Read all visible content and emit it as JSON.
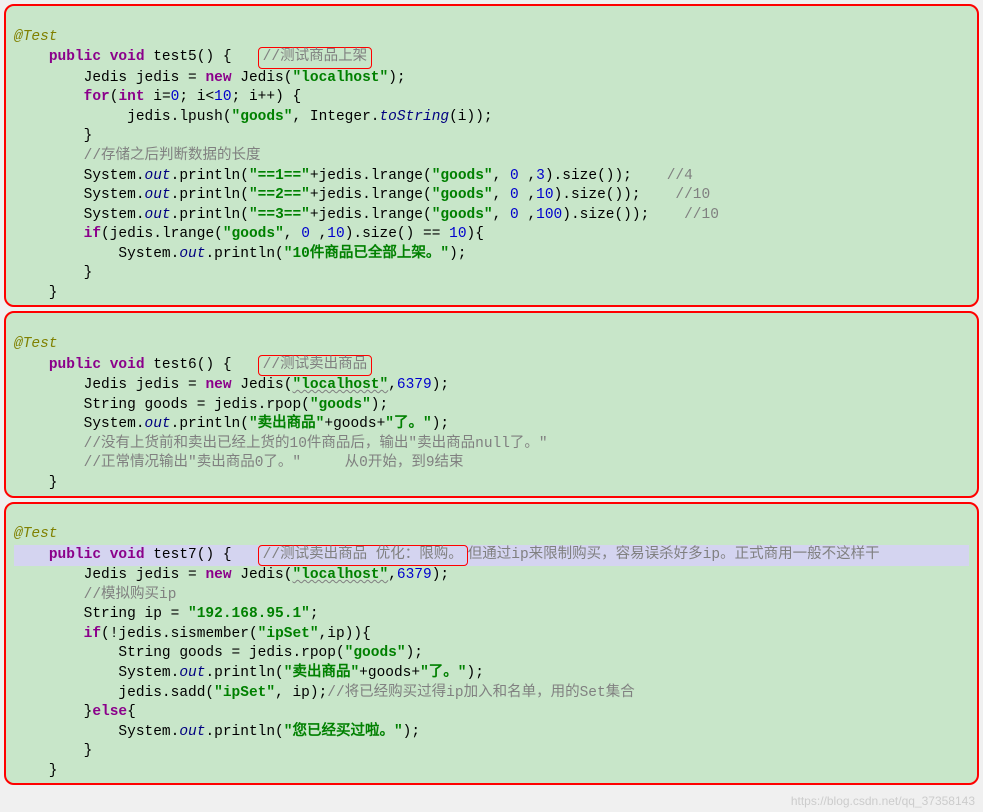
{
  "blocks": {
    "b1": {
      "anno": "@Test",
      "sig_pre": "public void",
      "sig_name": " test5",
      "sig_post": "() {",
      "boxed_comment": "//测试商品上架",
      "l1a": "        Jedis jedis = ",
      "l1new": "new",
      "l1b": " Jedis(",
      "l1str": "\"localhost\"",
      "l1c": ");",
      "l2a": "        ",
      "l2for": "for",
      "l2b": "(",
      "l2int": "int",
      "l2c": " i=",
      "l2n0": "0",
      "l2d": "; i<",
      "l2n10": "10",
      "l2e": "; i++) {",
      "l3a": "             jedis.lpush(",
      "l3s1": "\"goods\"",
      "l3b": ", Integer.",
      "l3ts": "toString",
      "l3c": "(i));",
      "l4": "        }",
      "l5c": "        //存储之后判断数据的长度",
      "l6a": "        System.",
      "l6out": "out",
      "l6b": ".println(",
      "l6s": "\"==1==\"",
      "l6c": "+jedis.lrange(",
      "l6s2": "\"goods\"",
      "l6d": ", ",
      "l6n0": "0",
      "l6e": " ,",
      "l6n3": "3",
      "l6f": ").size());    ",
      "l6cmt": "//4",
      "l7s": "\"==2==\"",
      "l7n10": "10",
      "l7cmt": "//10",
      "l8s": "\"==3==\"",
      "l8n100": "100",
      "l8cmt": "//10",
      "l9a": "        ",
      "l9if": "if",
      "l9b": "(jedis.lrange(",
      "l9s": "\"goods\"",
      "l9c": ", ",
      "l9n0": "0",
      "l9d": " ,",
      "l9n10": "10",
      "l9e": ").size() == ",
      "l9n10b": "10",
      "l9f": "){",
      "l10a": "            System.",
      "l10out": "out",
      "l10b": ".println(",
      "l10s": "\"10件商品已全部上架。\"",
      "l10c": ");",
      "l11": "        }",
      "l12": "    }"
    },
    "b2": {
      "anno": "@Test",
      "sig_pre": "public void",
      "sig_name": " test6",
      "sig_post": "() {",
      "boxed_comment": "//测试卖出商品",
      "l1a": "        Jedis jedis = ",
      "l1new": "new",
      "l1b": " Jedis(",
      "l1s": "\"localhost\"",
      "l1c": ",",
      "l1n": "6379",
      "l1d": ");",
      "l2a": "        String goods = jedis.rpop(",
      "l2s": "\"goods\"",
      "l2b": ");",
      "l3a": "        System.",
      "l3out": "out",
      "l3b": ".println(",
      "l3s1": "\"卖出商品\"",
      "l3c": "+goods+",
      "l3s2": "\"了。\"",
      "l3d": ");",
      "l4c": "        //没有上货前和卖出已经上货的10件商品后，输出\"卖出商品null了。\"",
      "l5c": "        //正常情况输出\"卖出商品0了。\"     从0开始，到9结束",
      "l6": "    }"
    },
    "b3": {
      "anno": "@Test",
      "sig_pre": "public void",
      "sig_name": " test7",
      "sig_post": "() {",
      "boxed_comment": "//测试卖出商品 优化：限购。",
      "tail_comment": "但通过ip来限制购买，容易误杀好多ip。正式商用一般不这样干",
      "l1a": "        Jedis jedis = ",
      "l1new": "new",
      "l1b": " Jedis(",
      "l1s": "\"localhost\"",
      "l1c": ",",
      "l1n": "6379",
      "l1d": ");",
      "l2c": "        //模拟购买ip",
      "l3a": "        String ip = ",
      "l3s": "\"192.168.95.1\"",
      "l3b": ";",
      "l4a": "        ",
      "l4if": "if",
      "l4b": "(!jedis.sismember(",
      "l4s": "\"ipSet\"",
      "l4c": ",ip)){",
      "l5a": "            String goods = jedis.rpop(",
      "l5s": "\"goods\"",
      "l5b": ");",
      "l6a": "            System.",
      "l6out": "out",
      "l6b": ".println(",
      "l6s1": "\"卖出商品\"",
      "l6c": "+goods+",
      "l6s2": "\"了。\"",
      "l6d": ");",
      "l7a": "            jedis.sadd(",
      "l7s": "\"ipSet\"",
      "l7b": ", ip);",
      "l7cmt": "//将已经购买过得ip加入和名单，用的Set集合",
      "l8a": "        }",
      "l8else": "else",
      "l8b": "{",
      "l9a": "            System.",
      "l9out": "out",
      "l9b": ".println(",
      "l9s": "\"您已经买过啦。\"",
      "l9c": ");",
      "l10": "        }",
      "l11": "    }"
    }
  },
  "watermark": "https://blog.csdn.net/qq_37358143"
}
